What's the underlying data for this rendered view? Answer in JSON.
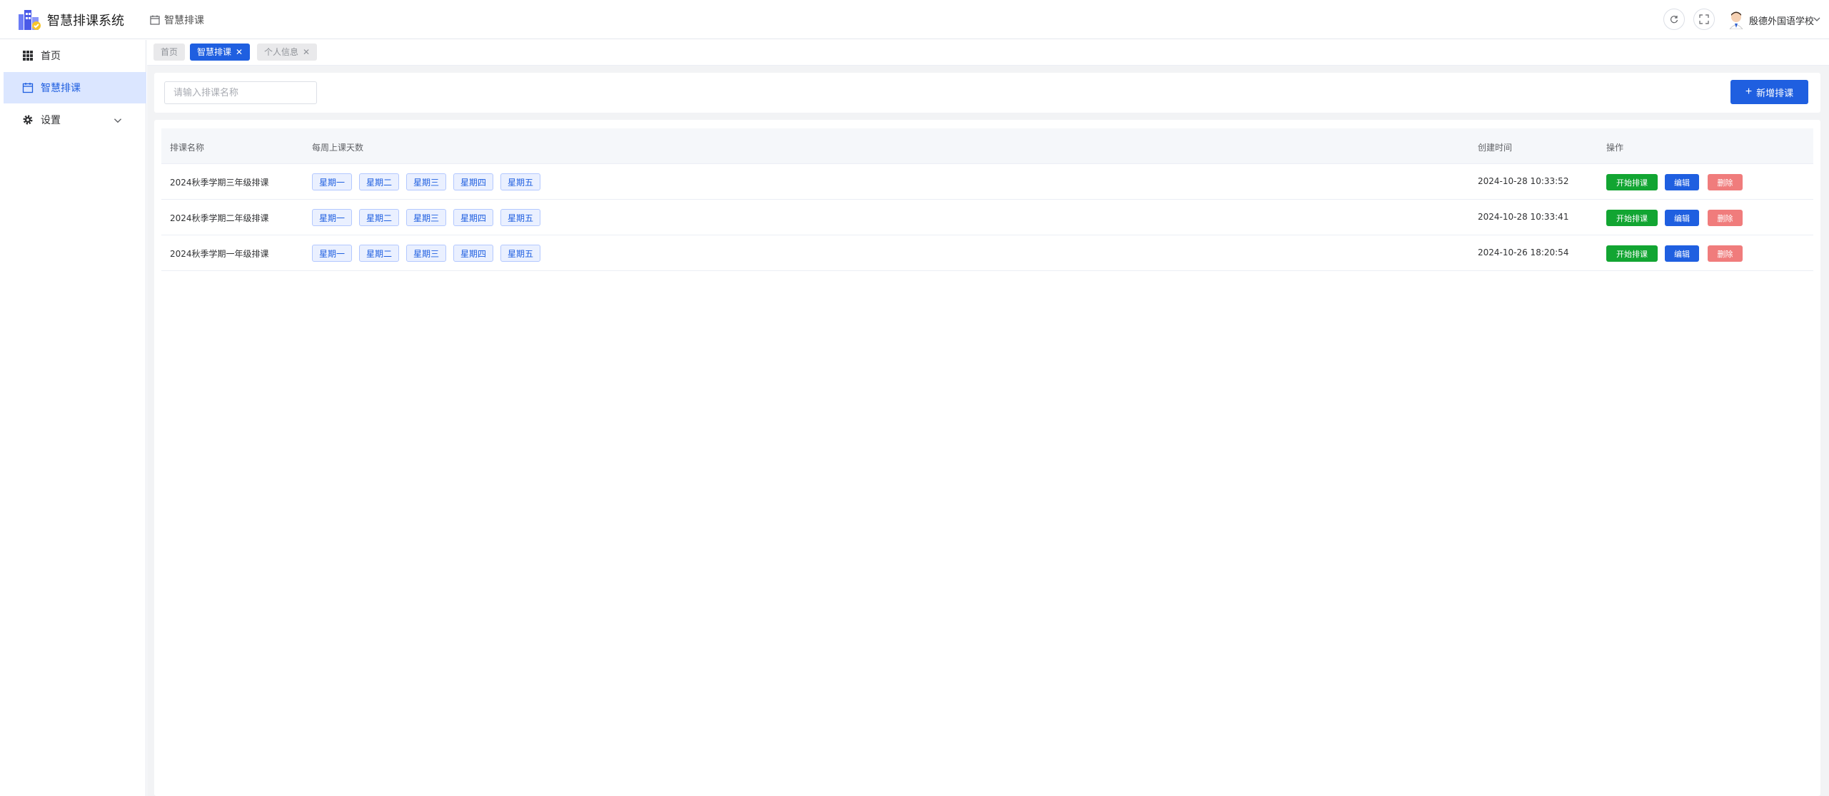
{
  "header": {
    "app_title": "智慧排课系统",
    "breadcrumb": "智慧排课",
    "user_name": "殷德外国语学校"
  },
  "sidebar": {
    "items": [
      {
        "label": "首页",
        "icon": "grid-icon"
      },
      {
        "label": "智慧排课",
        "icon": "calendar-icon"
      },
      {
        "label": "设置",
        "icon": "gear-icon"
      }
    ]
  },
  "tabs": [
    {
      "label": "首页"
    },
    {
      "label": "智慧排课"
    },
    {
      "label": "个人信息"
    }
  ],
  "search": {
    "placeholder": "请输入排课名称"
  },
  "toolbar": {
    "add_label": "新增排课"
  },
  "table": {
    "columns": [
      "排课名称",
      "每周上课天数",
      "创建时间",
      "操作"
    ],
    "rows": [
      {
        "name": "2024秋季学期三年级排课",
        "days": [
          "星期一",
          "星期二",
          "星期三",
          "星期四",
          "星期五"
        ],
        "created": "2024-10-28 10:33:52"
      },
      {
        "name": "2024秋季学期二年级排课",
        "days": [
          "星期一",
          "星期二",
          "星期三",
          "星期四",
          "星期五"
        ],
        "created": "2024-10-28 10:33:41"
      },
      {
        "name": "2024秋季学期一年级排课",
        "days": [
          "星期一",
          "星期二",
          "星期三",
          "星期四",
          "星期五"
        ],
        "created": "2024-10-26 18:20:54"
      }
    ],
    "actions": {
      "start": "开始排课",
      "edit": "编辑",
      "delete": "删除"
    }
  },
  "colors": {
    "primary": "#1f5fe0",
    "success": "#12a532",
    "danger": "#f07c7c"
  }
}
